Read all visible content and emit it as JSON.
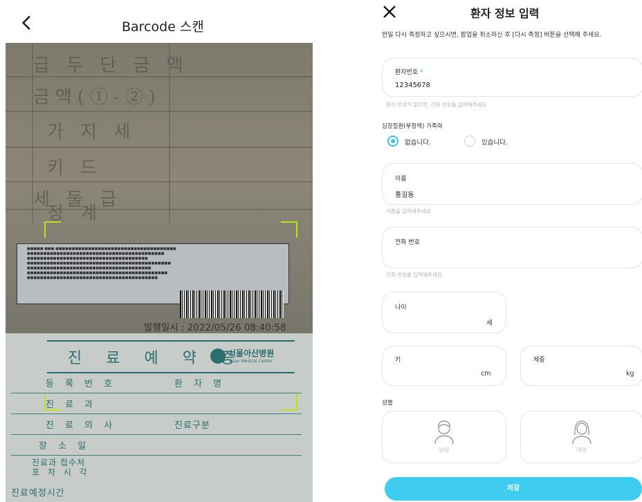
{
  "scan": {
    "title": "Barcode 스캔",
    "issued_at": "발행일시 : 2022/05/26 08:40:58",
    "appointment_title": "진 료 예 약 증",
    "hospital_name": "서울아산병원",
    "hospital_sub": "Asan Medical Center",
    "background_texts": [
      "급 두 단 금 액",
      "금액(①-②)",
      "가 지 세",
      "키 드",
      "세 둘 급",
      "정 계"
    ],
    "table_labels": [
      "등 록 번 호",
      "환 자 명",
      "진 료 과",
      "진 료 의 사",
      "진료구분",
      "장 소 일",
      "진료과 접수처",
      "포 차 시 각",
      "진료예정시간"
    ],
    "frame_color": "#b5e61d"
  },
  "form": {
    "title": "환자 정보 입력",
    "guide": "만일 다시 측정하고 싶으시면, 팝업을 취소하신 후 [다시 측정] 버튼을 선택해 주세요.",
    "patient_id": {
      "label": "환자번호",
      "required_mark": "*",
      "value": "12345678",
      "hint": "환자 번호가 없으면, 전화 번호를 입력해주세요"
    },
    "family_history": {
      "label": "심장질환(부정맥) 가족력",
      "options": [
        "없습니다.",
        "있습니다."
      ],
      "selected": "없습니다."
    },
    "name": {
      "label": "이름",
      "value": "홍길동",
      "hint": "이름을 입력해주세요"
    },
    "phone": {
      "label": "전화 번호",
      "value": "",
      "hint": "전화 번호를 입력해주세요."
    },
    "age": {
      "label": "나이",
      "unit": "세"
    },
    "height": {
      "label": "키",
      "unit": "cm"
    },
    "weight": {
      "label": "체중",
      "unit": "kg"
    },
    "gender": {
      "label": "성별",
      "options": [
        "남성",
        "여성"
      ]
    },
    "save_label": "저장",
    "accent_color": "#35c3e8"
  }
}
